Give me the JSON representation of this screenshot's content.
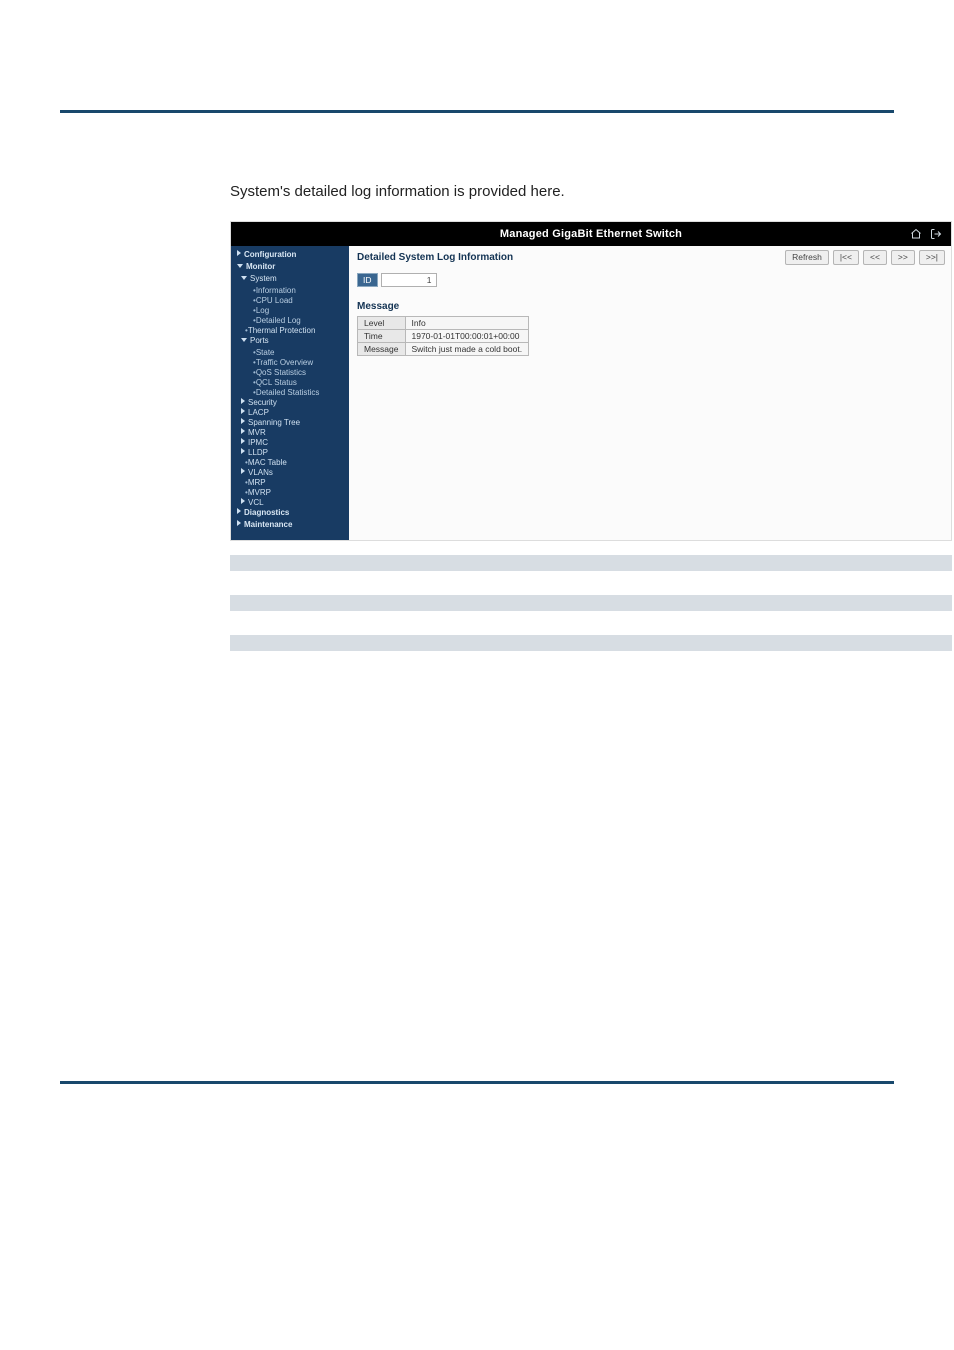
{
  "intro": {
    "text": "System's detailed log information is provided here."
  },
  "header": {
    "brand": "Managed GigaBit Ethernet Switch"
  },
  "sidebar": {
    "configuration": "Configuration",
    "monitor": "Monitor",
    "system": "System",
    "system_children": {
      "information": "Information",
      "cpu_load": "CPU Load",
      "log": "Log",
      "detailed_log": "Detailed Log"
    },
    "thermal_protection": "Thermal Protection",
    "ports": "Ports",
    "ports_children": {
      "state": "State",
      "traffic_overview": "Traffic Overview",
      "qos_statistics": "QoS Statistics",
      "qcl_status": "QCL Status",
      "detailed_statistics": "Detailed Statistics"
    },
    "security": "Security",
    "lacp": "LACP",
    "spanning_tree": "Spanning Tree",
    "mvr": "MVR",
    "ipmc": "IPMC",
    "lldp": "LLDP",
    "mac_table": "MAC Table",
    "vlans": "VLANs",
    "mrp": "MRP",
    "mvrp": "MVRP",
    "vcl": "VCL",
    "diagnostics": "Diagnostics",
    "maintenance": "Maintenance"
  },
  "content": {
    "title": "Detailed System Log Information",
    "id_label": "ID",
    "id_value": "1",
    "message_header": "Message",
    "rows": {
      "level_k": "Level",
      "level_v": "Info",
      "time_k": "Time",
      "time_v": "1970-01-01T00:00:01+00:00",
      "message_k": "Message",
      "message_v": "Switch just made a cold boot."
    },
    "buttons": {
      "refresh": "Refresh",
      "first": "|<<",
      "prev": "<<",
      "next": ">>",
      "last": ">>|"
    }
  }
}
